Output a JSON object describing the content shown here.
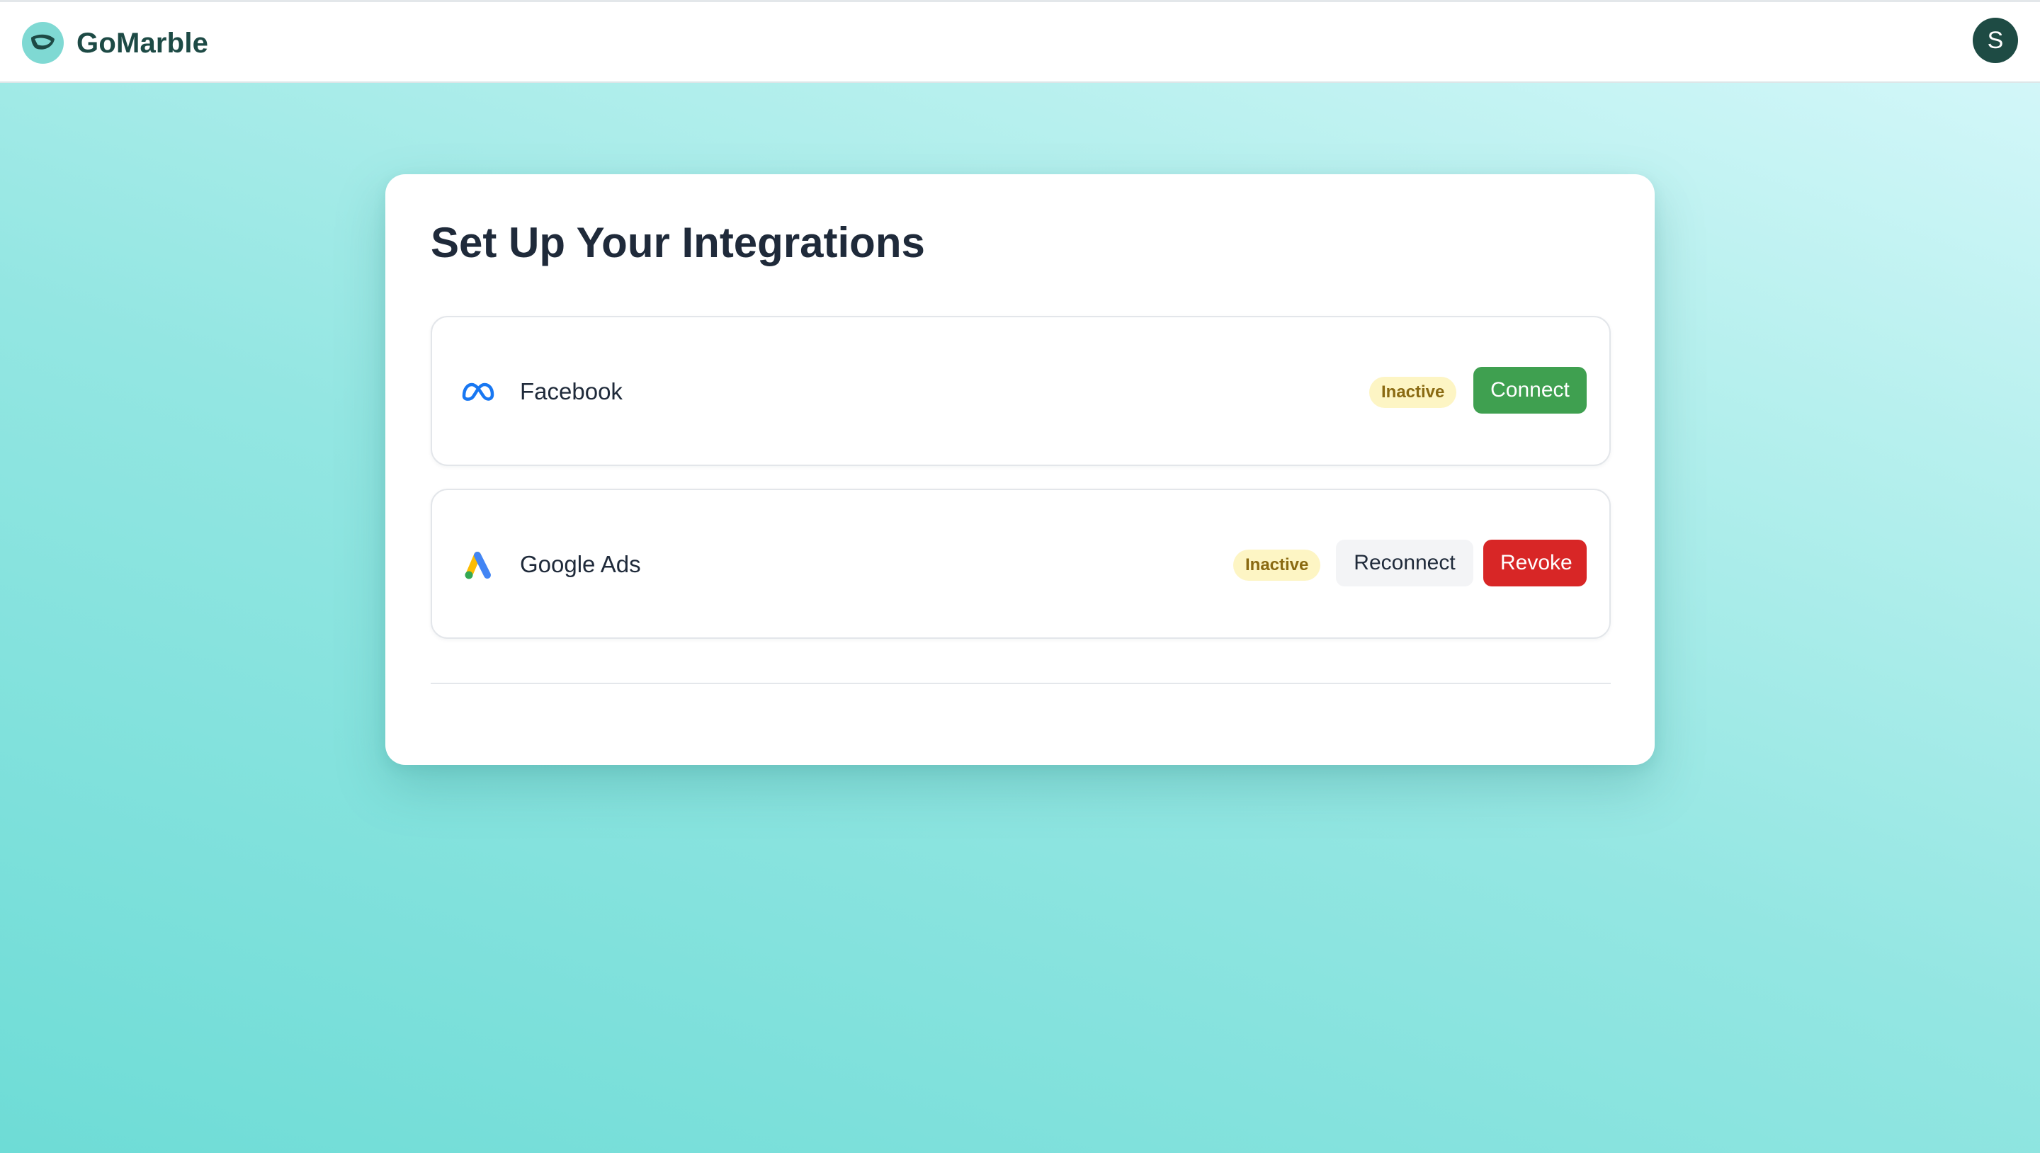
{
  "header": {
    "brand": "GoMarble",
    "logo_icon": "leaf-icon",
    "avatar_initial": "S"
  },
  "main": {
    "title": "Set Up Your Integrations",
    "integrations": [
      {
        "name": "Facebook",
        "icon": "meta-icon",
        "status": "Inactive",
        "actions": [
          "Connect"
        ]
      },
      {
        "name": "Google Ads",
        "icon": "google-ads-icon",
        "status": "Inactive",
        "actions": [
          "Reconnect",
          "Revoke"
        ]
      }
    ]
  },
  "colors": {
    "brand_dark": "#1d4a45",
    "connect": "#3fa050",
    "revoke": "#d82626",
    "inactive_bg": "#fdf5c4",
    "inactive_text": "#8a6a12"
  }
}
